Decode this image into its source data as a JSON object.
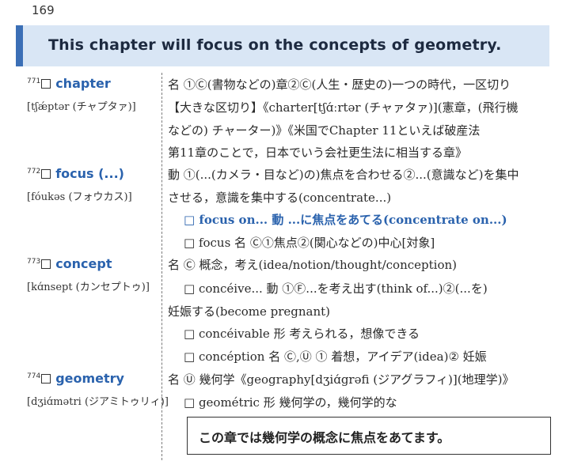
{
  "page_number": "169",
  "banner": "This chapter will focus on the concepts of geometry.",
  "entries": [
    {
      "num": "771",
      "word": "chapter",
      "pron": "[tʃǽptər (チャプタァ)]",
      "lines": [
        "名 ①Ⓒ(書物などの)章②Ⓒ(人生・歴史の)一つの時代，一区切り",
        "【大きな区切り】《charter[tʃɑ́ːrtər (チャァタァ)](憲章，(飛行機",
        "などの) チャーター)》《米国でChapter 11といえば破産法",
        "第11章のことで，日本でいう会社更生法に相当する章》"
      ]
    },
    {
      "num": "772",
      "word": "focus (...)",
      "pron": "[fóukəs (フォウカス)]",
      "lines": [
        "動 ①(...(カメラ・目など)の)焦点を合わせる②...(意識など)を集中",
        "させる，意識を集中する(concentrate...)",
        "□ focus on... 動 ...に焦点をあてる(concentrate on...)",
        "□ focus 名 Ⓒ①焦点②(関心などの)中心[対象]"
      ]
    },
    {
      "num": "773",
      "word": "concept",
      "pron": "[kɑ́nsept (カンセプトゥ)]",
      "lines": [
        "名 Ⓒ 概念，考え(idea/notion/thought/conception)",
        "□ concéive... 動 ①Ⓕ...を考え出す(think of...)②(...を)",
        "妊娠する(become pregnant)",
        "□ concéivable 形 考えられる，想像できる",
        "□ concéption 名 Ⓒ,Ⓤ ① 着想，アイデア(idea)② 妊娠"
      ]
    },
    {
      "num": "774",
      "word": "geometry",
      "pron": "[dʒiɑ́mətri (ジアミトゥリィ)]",
      "lines": [
        "名 Ⓤ 幾何学《geography[dʒiɑ́grəfi (ジアグラフィ)](地理学)》",
        "□ geométric 形 幾何学の，幾何学的な"
      ]
    }
  ],
  "example_sentence": "この章では幾何学の概念に焦点をあてます。"
}
